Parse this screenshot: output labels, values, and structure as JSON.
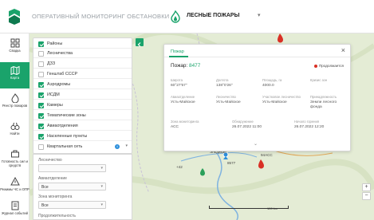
{
  "header": {
    "app_title": "ОПЕРАТИВНЫЙ МОНИТОРИНГ ОБСТАНОВКИ",
    "module_title": "ЛЕСНЫЕ ПОЖАРЫ",
    "module_caret": "▾"
  },
  "nav": [
    {
      "label": "Сводка",
      "icon": "dashboard-icon"
    },
    {
      "label": "Карта",
      "icon": "map-icon",
      "active": true
    },
    {
      "label": "Реестр пожаров",
      "icon": "fire-registry-icon"
    },
    {
      "label": "Найти",
      "icon": "binoculars-icon"
    },
    {
      "label": "Готовность сил и средств",
      "icon": "forces-icon"
    },
    {
      "label": "Режимы ЧС и ОПР",
      "icon": "emergency-modes-icon"
    },
    {
      "label": "Журнал событий",
      "icon": "journal-icon"
    }
  ],
  "layers": {
    "items": [
      {
        "label": "Районы",
        "checked": true
      },
      {
        "label": "Лесничества",
        "checked": false
      },
      {
        "label": "ДЗЗ",
        "checked": false
      },
      {
        "label": "Генштаб СССР",
        "checked": false
      },
      {
        "label": "Аэродромы",
        "checked": true
      },
      {
        "label": "ИСДМ",
        "checked": true
      },
      {
        "label": "Камеры",
        "checked": true
      },
      {
        "label": "Тематические зоны",
        "checked": true
      },
      {
        "label": "Авиаотделения",
        "checked": true
      },
      {
        "label": "Населенные пункты",
        "checked": true
      },
      {
        "label": "Квартальная сеть",
        "checked": false,
        "info": "i",
        "caret": "▾"
      }
    ],
    "toggle_icon": "chevron-left-icon"
  },
  "filters": {
    "forestry_label": "Лесничество",
    "forestry_value": "",
    "aviation_label": "Авиаотделение",
    "aviation_value": "Все",
    "zone_label": "Зона мониторинга",
    "zone_value": "Все",
    "duration_label": "Продолжительность",
    "caret": "▾"
  },
  "popup": {
    "tab": "Пожар",
    "close": "×",
    "title_prefix": "Пожар:",
    "fire_number": "8477",
    "status": "Продолжается",
    "status_color": "#d93025",
    "fields": [
      {
        "label": "Широта",
        "value": "60°27'57\""
      },
      {
        "label": "Долгота",
        "value": "138°0'26\""
      },
      {
        "label": "Площадь, га",
        "value": "4000.0"
      },
      {
        "label": "Кризис зон",
        "value": ""
      },
      {
        "label": "Авиаотделение",
        "value": "Усть-Майское"
      },
      {
        "label": "Лесничество",
        "value": "Усть-Майское"
      },
      {
        "label": "Участковое лесничество",
        "value": "Усть-Майское"
      },
      {
        "label": "Принадлежность",
        "value": "Земли лесного фонда"
      },
      {
        "label": "Зона мониторинга",
        "value": "АСС"
      },
      {
        "label": "Обнаружение",
        "value": "26.07.2022 11:00"
      },
      {
        "label": "Начало горения",
        "value": "26.07.2022 12:20"
      }
    ],
    "expand": "⌄"
  },
  "map": {
    "labels": [
      "Эльдикан",
      "94АСС",
      "8577",
      "+42"
    ],
    "scale": "100 km",
    "zoom_in": "+",
    "zoom_out": "−",
    "accent": "#1aa36b"
  }
}
